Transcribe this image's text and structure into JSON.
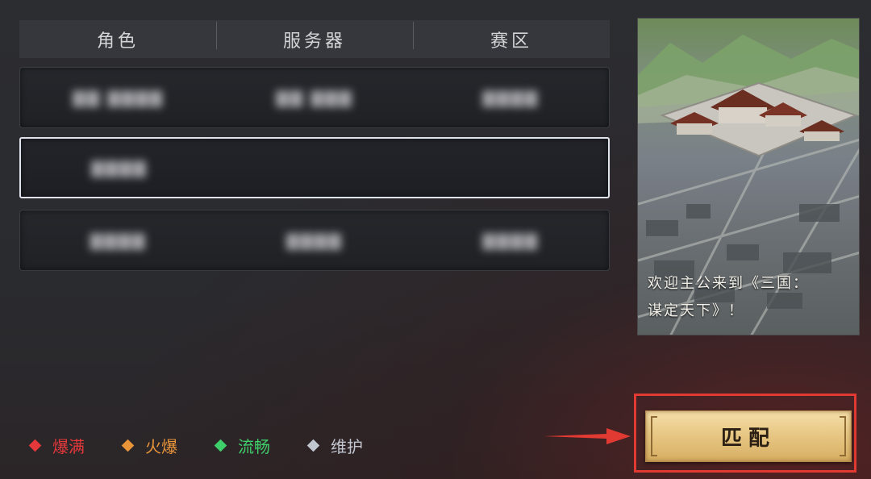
{
  "table": {
    "headers": [
      "角色",
      "服务器",
      "赛区"
    ],
    "rows": [
      {
        "role": "▇▇ ▇▇▇▇",
        "server": "▇▇ ▇▇▇",
        "zone": "▇▇▇▇",
        "selected": false
      },
      {
        "role": "▇▇▇▇",
        "server": "",
        "zone": "",
        "selected": true
      },
      {
        "role": "▇▇▇▇",
        "server": "▇▇▇▇",
        "zone": "▇▇▇▇",
        "selected": false
      }
    ]
  },
  "banner": {
    "caption_line1": "欢迎主公来到《三国：",
    "caption_line2": "谋定天下》！"
  },
  "legend": [
    {
      "label": "爆满",
      "color": "#e5383b"
    },
    {
      "label": "火爆",
      "color": "#e8953a"
    },
    {
      "label": "流畅",
      "color": "#3fcf6a"
    },
    {
      "label": "维护",
      "color": "#c2c6d0"
    }
  ],
  "match_button": {
    "label": "匹配"
  },
  "colors": {
    "highlight_frame": "#e03a32",
    "arrow": "#e03a32"
  }
}
